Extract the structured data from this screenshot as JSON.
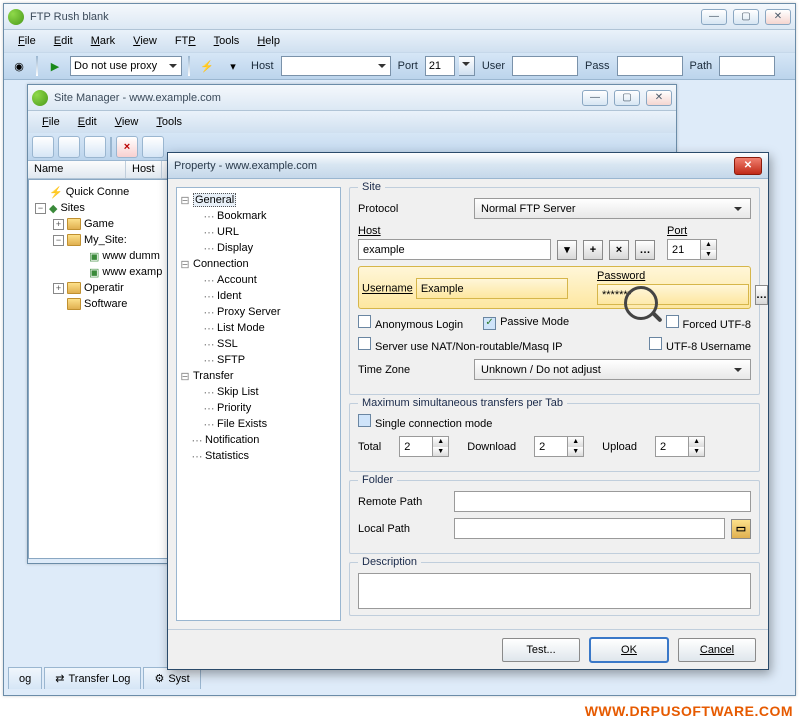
{
  "main": {
    "title": "FTP Rush   blank",
    "menu": [
      "File",
      "Edit",
      "Mark",
      "View",
      "FTP",
      "Tools",
      "Help"
    ],
    "proxy_selected": "Do not use proxy",
    "host_label": "Host",
    "port_label": "Port",
    "port_value": "21",
    "user_label": "User",
    "pass_label": "Pass",
    "path_label": "Path",
    "tabs": [
      "og",
      "Transfer Log",
      "Syst"
    ]
  },
  "sm": {
    "title": "Site Manager  -  www.example.com",
    "menu": [
      "File",
      "Edit",
      "View",
      "Tools"
    ],
    "list_headers": [
      "Name",
      "Host"
    ],
    "tree": {
      "quick": "Quick Conne",
      "sites": "Sites",
      "game": "Game",
      "mysites": "My_Site:",
      "dummy": "www dumm",
      "example": "www examp",
      "operatir": "Operatir",
      "software": "Software"
    }
  },
  "dlg": {
    "title": "Property - www.example.com",
    "nav": {
      "general": "General",
      "bookmark": "Bookmark",
      "url": "URL",
      "display": "Display",
      "connection": "Connection",
      "account": "Account",
      "ident": "Ident",
      "proxy": "Proxy Server",
      "listmode": "List Mode",
      "ssl": "SSL",
      "sftp": "SFTP",
      "transfer": "Transfer",
      "skip": "Skip List",
      "priority": "Priority",
      "fileexists": "File Exists",
      "notification": "Notification",
      "statistics": "Statistics"
    },
    "site": {
      "legend": "Site",
      "protocol_label": "Protocol",
      "protocol_value": "Normal FTP Server",
      "host_label": "Host",
      "host_value": "example",
      "port_label": "Port",
      "port_value": "21",
      "user_label": "Username",
      "user_value": "Example",
      "pass_label": "Password",
      "pass_value": "*******",
      "cb_anon": "Anonymous Login",
      "cb_passive": "Passive Mode",
      "cb_utf8": "Forced UTF-8",
      "cb_nat": "Server use NAT/Non-routable/Masq IP",
      "cb_utf8u": "UTF-8 Username",
      "tz_label": "Time Zone",
      "tz_value": "Unknown / Do not adjust"
    },
    "trans": {
      "legend": "Maximum simultaneous transfers per Tab",
      "single": "Single connection mode",
      "total_label": "Total",
      "total": "2",
      "download_label": "Download",
      "download": "2",
      "upload_label": "Upload",
      "upload": "2"
    },
    "folder": {
      "legend": "Folder",
      "remote": "Remote Path",
      "local": "Local Path"
    },
    "desc": {
      "legend": "Description"
    },
    "buttons": {
      "test": "Test...",
      "ok": "OK",
      "cancel": "Cancel"
    }
  },
  "watermark": "WWW.DRPUSOFTWARE.COM"
}
